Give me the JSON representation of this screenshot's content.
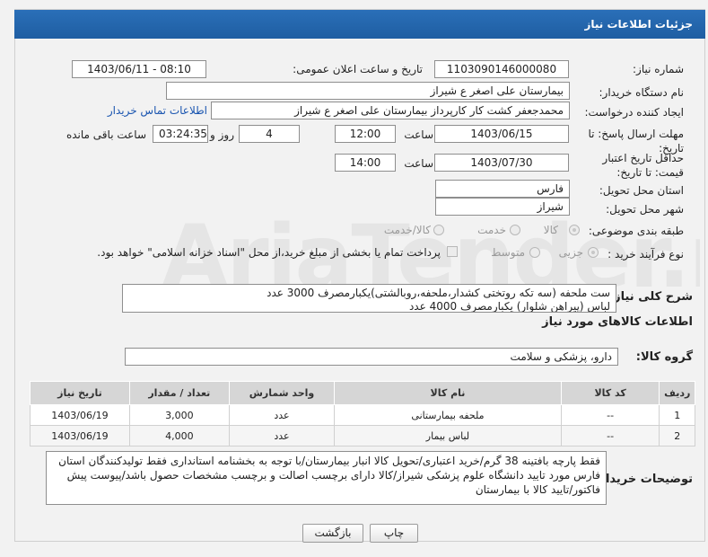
{
  "page": {
    "title": "جزئیات اطلاعات نیاز",
    "watermark": "AriaTender.neT"
  },
  "fields": {
    "need_number_label": "شماره نیاز:",
    "need_number": "1103090146000080",
    "announce_label": "تاریخ و ساعت اعلان عمومی:",
    "announce_value": "1403/06/11 - 08:10",
    "buyer_org_label": "نام دستگاه خریدار:",
    "buyer_org": "بیمارستان علی اصغر  ع  شیراز",
    "creator_label": "ایجاد کننده درخواست:",
    "creator": "محمدجعفر کشت کار کارپرداز بیمارستان علی اصغر  ع  شیراز",
    "contact_link": "اطلاعات تماس خریدار",
    "deadline_label": "مهلت ارسال پاسخ: تا تاریخ:",
    "deadline_date": "1403/06/15",
    "time_label": "ساعت",
    "deadline_time": "12:00",
    "days_value": "4",
    "days_label": "روز و",
    "remaining_time": "03:24:35",
    "remaining_label": "ساعت باقی مانده",
    "price_validity_label": "حداقل تاریخ اعتبار قیمت: تا تاریخ:",
    "price_validity_date": "1403/07/30",
    "price_validity_time": "14:00",
    "province_label": "استان محل تحویل:",
    "province": "فارس",
    "city_label": "شهر محل تحویل:",
    "city": "شیراز",
    "category_label": "طبقه بندی موضوعی:",
    "category_options": [
      "کالا",
      "خدمت",
      "کالا/خدمت"
    ],
    "process_label": "نوع فرآیند خرید :",
    "process_options": [
      "جزیی",
      "متوسط"
    ],
    "payment_note": "پرداخت تمام یا بخشی از مبلغ خرید،از محل \"اسناد خزانه اسلامی\" خواهد بود."
  },
  "summary": {
    "label": "شرح کلی نیاز:",
    "line1": "ست ملحفه (سه تکه روتختی کشدار،ملحفه،روبالشتی)یکبارمصرف   3000 عدد",
    "line2": "لباس (پیراهن شلوار)  یکبارمصرف    4000 عدد"
  },
  "goods": {
    "section_title": "اطلاعات کالاهای مورد نیاز",
    "group_label": "گروه کالا:",
    "group_value": "دارو، پزشکی و سلامت",
    "columns": [
      "ردیف",
      "کد کالا",
      "نام کالا",
      "واحد شمارش",
      "تعداد / مقدار",
      "تاریخ نیاز"
    ],
    "rows": [
      [
        "1",
        "--",
        "ملحفه بیمارستانی",
        "عدد",
        "3,000",
        "1403/06/19"
      ],
      [
        "2",
        "--",
        "لباس بیمار",
        "عدد",
        "4,000",
        "1403/06/19"
      ]
    ]
  },
  "buyer_notes": {
    "label": "توضیحات خریدار:",
    "text": "فقط پارچه بافتینه 38 گرم/خرید اعتباری/تحویل کالا انبار بیمارستان/با توجه به بخشنامه استانداری فقط تولیدکنندگان استان فارس مورد تایید دانشگاه علوم پزشکی شیراز/کالا دارای برچسب اصالت و برچسب مشخصات حصول باشد/پیوست پیش فاکتور/تایید کالا با بیمارستان"
  },
  "buttons": {
    "print": "چاپ",
    "back": "بازگشت"
  }
}
